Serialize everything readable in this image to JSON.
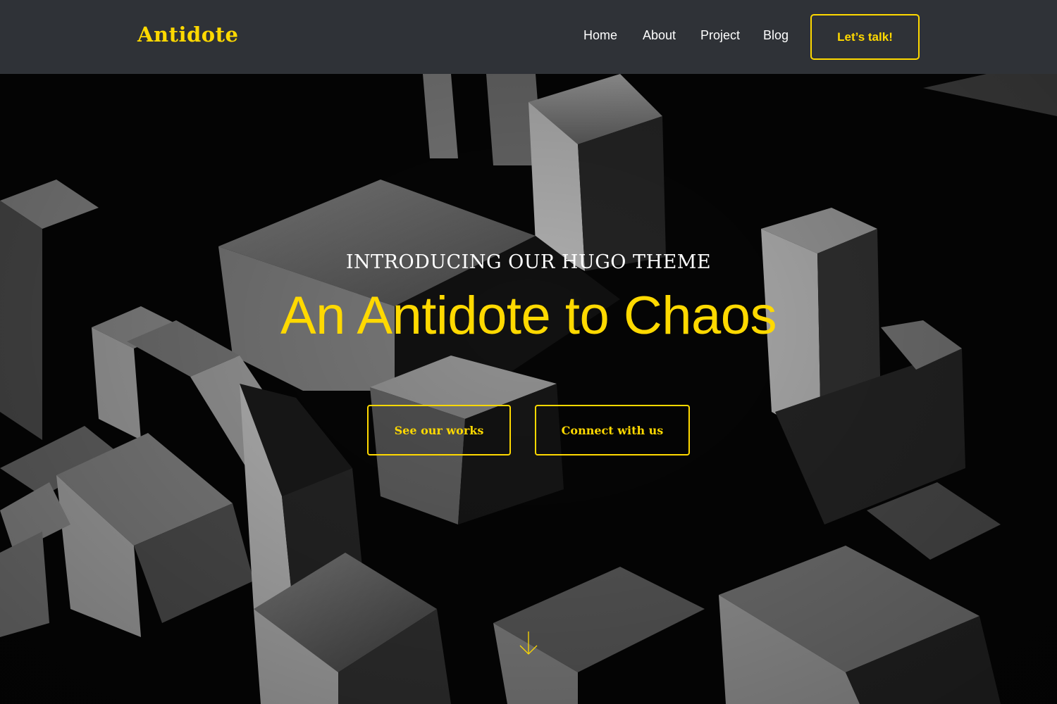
{
  "nav": {
    "brand": "Antidote",
    "links": [
      {
        "label": "Home"
      },
      {
        "label": "About"
      },
      {
        "label": "Project"
      },
      {
        "label": "Blog"
      }
    ],
    "cta_label": "Let’s talk!"
  },
  "hero": {
    "eyebrow": "INTRODUCING OUR HUGO THEME",
    "headline": "An Antidote to Chaos",
    "primary_button": "See our works",
    "secondary_button": "Connect with us",
    "scroll_icon": "arrow-down-icon"
  },
  "colors": {
    "accent": "#ffd900",
    "navbar_bg": "#2f3237",
    "text_light": "#ffffff"
  }
}
